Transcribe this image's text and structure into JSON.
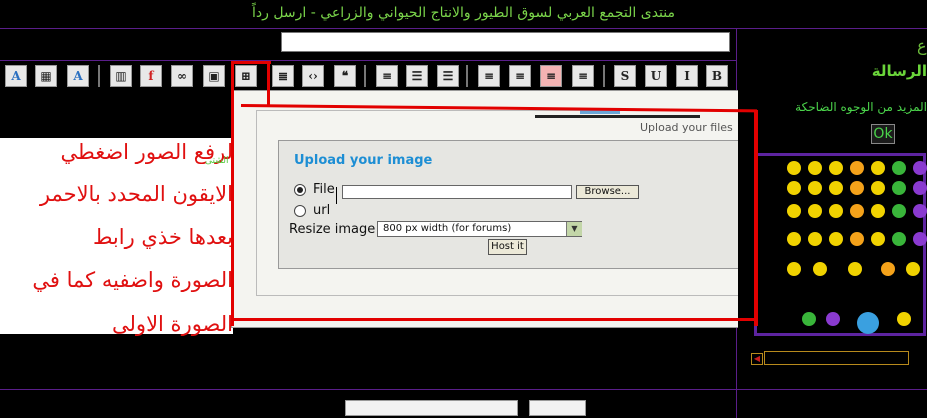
{
  "header": {
    "title": "منتدى التجمع العربي لسوق الطيور والانتاج الحيواني والزراعي - ارسل رداً"
  },
  "top_right_glyph": "ع",
  "toolbar": {
    "buttons": [
      {
        "name": "text-color",
        "glyph": "A"
      },
      {
        "name": "background-color",
        "glyph": "▦"
      },
      {
        "name": "font-face",
        "glyph": "A"
      },
      {
        "name": "insert-video",
        "glyph": "▥"
      },
      {
        "name": "insert-flash",
        "glyph": "f"
      },
      {
        "name": "insert-link",
        "glyph": "∞"
      },
      {
        "name": "insert-image",
        "glyph": "▣"
      },
      {
        "name": "upload-image",
        "glyph": "⊞"
      },
      {
        "name": "insert-code",
        "glyph": "≣"
      },
      {
        "name": "insert-html",
        "glyph": "‹›"
      },
      {
        "name": "insert-quote",
        "glyph": "❝"
      },
      {
        "name": "insert-horizontal-line",
        "glyph": "≡"
      },
      {
        "name": "numbered-list",
        "glyph": "☰"
      },
      {
        "name": "bullet-list",
        "glyph": "☰"
      },
      {
        "name": "justify",
        "glyph": "≡"
      },
      {
        "name": "align-right",
        "glyph": "≡"
      },
      {
        "name": "align-center",
        "glyph": "≡"
      },
      {
        "name": "align-left",
        "glyph": "≡"
      },
      {
        "name": "strikethrough",
        "glyph": "S"
      },
      {
        "name": "underline",
        "glyph": "U"
      },
      {
        "name": "italic",
        "glyph": "I"
      },
      {
        "name": "bold",
        "glyph": "B"
      }
    ]
  },
  "editor": {
    "lines": [
      "لرفع الصور اضغطي",
      "الايقون المحدد بالاحمر",
      "بعدها خذي رابط",
      "الصورة واضفيه كما في",
      "الصورة الاولى"
    ],
    "small_note": "نور في الشتى"
  },
  "upload_popup": {
    "tagline": "Upload your files",
    "heading": "Upload your image",
    "file_label": "File",
    "url_label": "url",
    "browse_label": "Browse...",
    "resize_label": "Resize image",
    "resize_value": "800 px width (for forums)",
    "host_label": "Host it"
  },
  "right_panel": {
    "heading": "الرسالة",
    "more_link": "المزيد من الوجوه الضاحكة",
    "ok_label": "Ok"
  },
  "colors": {
    "accent_green": "#7ad44a",
    "annotation_red": "#e20000",
    "frame_purple": "#5d24a0",
    "heading_blue": "#1d8ed4"
  }
}
